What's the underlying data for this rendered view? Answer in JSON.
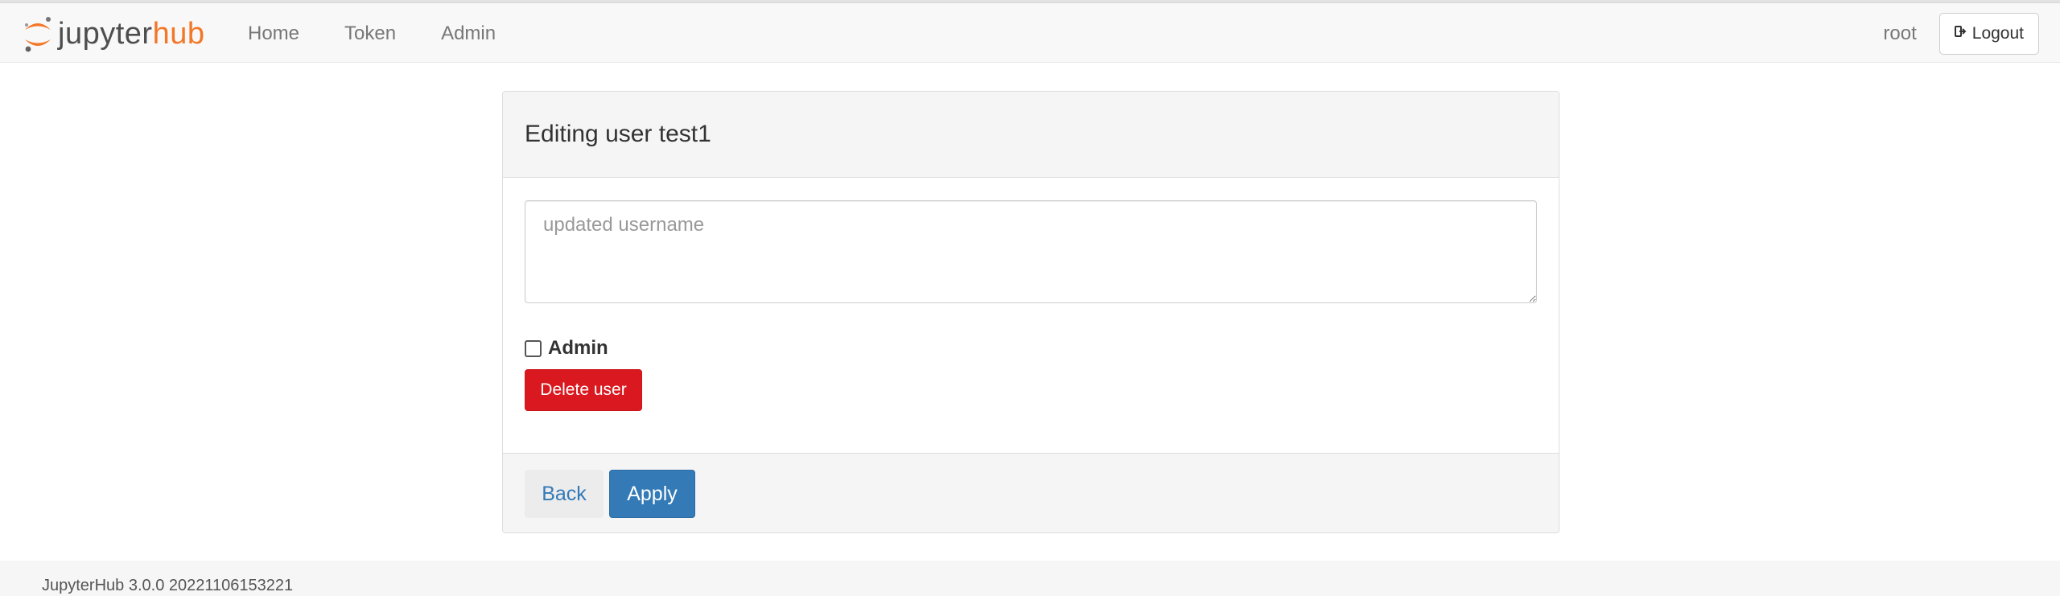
{
  "navbar": {
    "brand": {
      "jupyter": "jupyter",
      "hub": "hub"
    },
    "links": [
      {
        "label": "Home"
      },
      {
        "label": "Token"
      },
      {
        "label": "Admin"
      }
    ],
    "user": "root",
    "logout_label": "Logout",
    "logout_icon": "sign-out-icon"
  },
  "panel": {
    "title": "Editing user test1",
    "username_placeholder": "updated username",
    "username_value": "",
    "admin_label": "Admin",
    "admin_checked": false,
    "delete_label": "Delete user",
    "back_label": "Back",
    "apply_label": "Apply"
  },
  "footer": {
    "version": "JupyterHub 3.0.0 20221106153221"
  },
  "colors": {
    "brand_orange": "#f37726",
    "primary": "#337ab7",
    "danger": "#d9191f"
  }
}
